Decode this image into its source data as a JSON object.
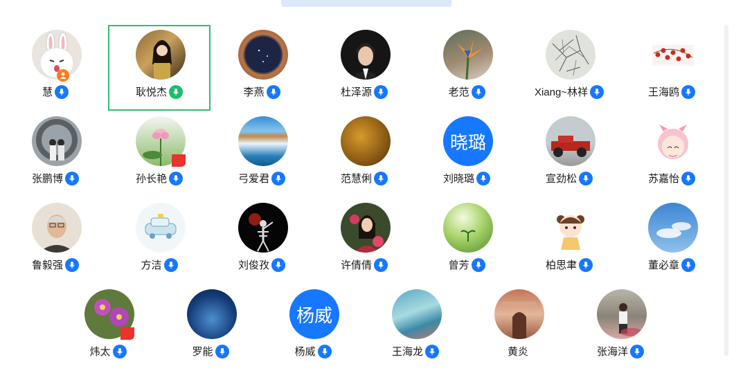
{
  "colors": {
    "accent": "#1677ff",
    "active_border": "#2fbd6c",
    "speaking": "#19be6b"
  },
  "participants": [
    {
      "name": "慧",
      "avatar": "cartoon-rabbit",
      "mic": "blue",
      "badge": "host-icon"
    },
    {
      "name": "耿悦杰",
      "avatar": "photo",
      "mic": "green",
      "active": true
    },
    {
      "name": "李燕",
      "avatar": "photo",
      "mic": "blue"
    },
    {
      "name": "杜泽源",
      "avatar": "photo",
      "mic": "blue"
    },
    {
      "name": "老范",
      "avatar": "photo",
      "mic": "blue"
    },
    {
      "name": "Xiang~林祥",
      "avatar": "photo",
      "mic": "blue"
    },
    {
      "name": "王海鸥",
      "avatar": "photo",
      "mic": "blue"
    },
    {
      "name": "张鹏博",
      "avatar": "photo",
      "mic": "blue"
    },
    {
      "name": "孙长艳",
      "avatar": "photo",
      "mic": "blue",
      "flag": true
    },
    {
      "name": "弓爱君",
      "avatar": "photo",
      "mic": "blue"
    },
    {
      "name": "范慧俐",
      "avatar": "photo",
      "mic": "blue"
    },
    {
      "name": "刘晓璐",
      "avatar_text": "晓璐",
      "mic": "blue"
    },
    {
      "name": "宣劲松",
      "avatar": "photo",
      "mic": "blue"
    },
    {
      "name": "苏嘉怡",
      "avatar": "cartoon",
      "mic": "blue"
    },
    {
      "name": "鲁毅强",
      "avatar": "photo",
      "mic": "blue"
    },
    {
      "name": "方洁",
      "avatar": "cartoon-car",
      "mic": "blue"
    },
    {
      "name": "刘俊孜",
      "avatar": "photo",
      "mic": "blue"
    },
    {
      "name": "许倩倩",
      "avatar": "photo",
      "mic": "blue"
    },
    {
      "name": "曾芳",
      "avatar": "photo",
      "mic": "blue"
    },
    {
      "name": "柏思聿",
      "avatar": "cartoon-girl",
      "mic": "blue"
    },
    {
      "name": "董必章",
      "avatar": "photo",
      "mic": "blue"
    },
    {
      "name": "炜太",
      "avatar": "photo",
      "mic": "blue",
      "flag": true
    },
    {
      "name": "罗能",
      "avatar": "photo",
      "mic": "blue"
    },
    {
      "name": "杨威",
      "avatar_text": "杨威",
      "mic": "blue"
    },
    {
      "name": "王海龙",
      "avatar": "photo",
      "mic": "blue"
    },
    {
      "name": "黄炎",
      "avatar": "photo",
      "mic": "none"
    },
    {
      "name": "张海洋",
      "avatar": "photo",
      "mic": "blue"
    }
  ]
}
